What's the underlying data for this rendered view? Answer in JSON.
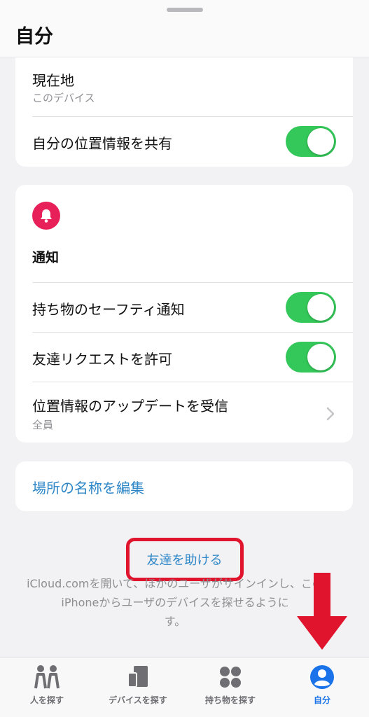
{
  "header": {
    "title": "自分"
  },
  "location_card": {
    "current_location_label": "現在地",
    "current_location_value": "このデバイス",
    "share_location_label": "自分の位置情報を共有",
    "share_location_on": true
  },
  "notifications_card": {
    "icon": "bell-icon",
    "title": "通知",
    "items": [
      {
        "label": "持ち物のセーフティ通知",
        "toggle_on": true
      },
      {
        "label": "友達リクエストを許可",
        "toggle_on": true
      }
    ],
    "updates_label": "位置情報のアップデートを受信",
    "updates_value": "全員"
  },
  "edit_places": {
    "label": "場所の名称を編集"
  },
  "help": {
    "link": "友達を助ける",
    "description": "iCloud.comを開いて、ほかのユーザがサインインし、このiPhoneからユーザのデバイスを探せるように",
    "description_end": "す。"
  },
  "tabs": [
    {
      "label": "人を探す",
      "icon": "people-icon",
      "active": false
    },
    {
      "label": "デバイスを探す",
      "icon": "devices-icon",
      "active": false
    },
    {
      "label": "持ち物を探す",
      "icon": "items-icon",
      "active": false
    },
    {
      "label": "自分",
      "icon": "person-circle-icon",
      "active": true
    }
  ],
  "colors": {
    "accent": "#1a73e8",
    "link": "#2d86c7",
    "toggle_on": "#34c759",
    "bell": "#e8205a",
    "highlight": "#e0142d"
  }
}
